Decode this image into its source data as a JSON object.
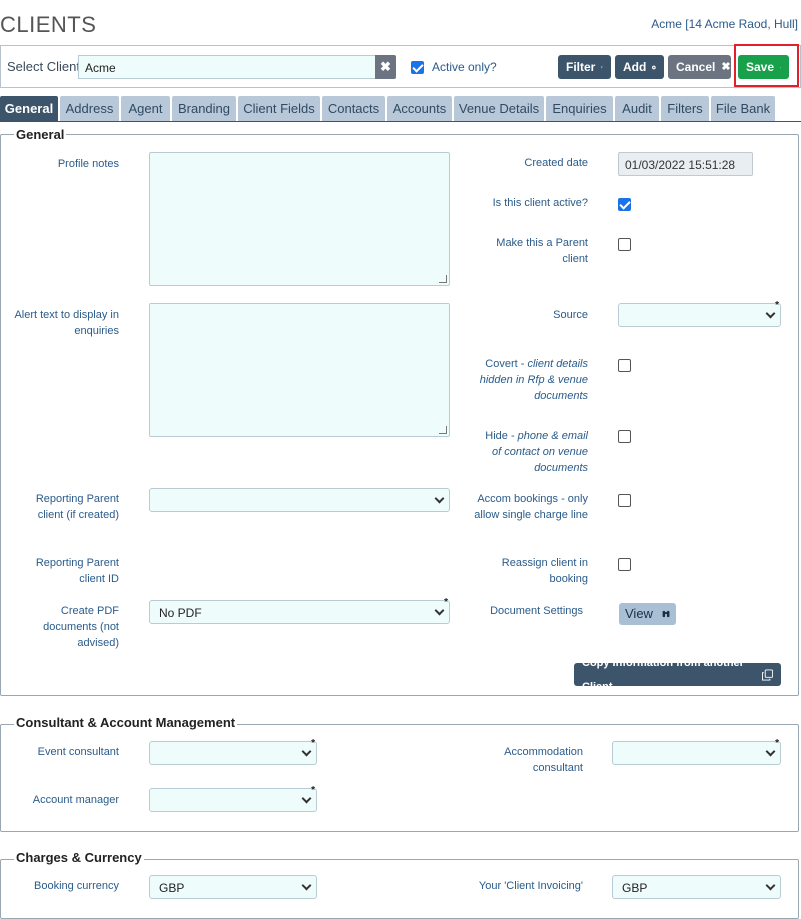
{
  "header": {
    "title": "CLIENTS",
    "client_address": "Acme [14 Acme Raod, Hull]"
  },
  "select_bar": {
    "label": "Select Client",
    "value": "Acme",
    "clear_icon": "times-icon",
    "active_only_label": "Active only?",
    "active_only_checked": true
  },
  "toolbar": {
    "filter": "Filter",
    "add": "Add",
    "cancel": "Cancel",
    "save": "Save"
  },
  "tabs": [
    "General",
    "Address",
    "Agent",
    "Branding",
    "Client Fields",
    "Contacts",
    "Accounts",
    "Venue Details",
    "Enquiries",
    "Audit",
    "Filters",
    "File Bank"
  ],
  "general": {
    "legend": "General",
    "profile_notes_label": "Profile notes",
    "alert_text_label": "Alert text to display in enquiries",
    "reporting_parent_label": "Reporting Parent client (if created)",
    "reporting_parent_id_label": "Reporting Parent client ID",
    "create_pdf_label": "Create PDF documents (not advised)",
    "create_pdf_value": "No PDF",
    "created_date_label": "Created date",
    "created_date_value": "01/03/2022 15:51:28",
    "client_active_label": "Is this client active?",
    "client_active_checked": true,
    "make_parent_label": "Make this a Parent client",
    "source_label": "Source",
    "covert_label_plain": "Covert - ",
    "covert_label_italic": "client details hidden in Rfp & venue documents",
    "hide_label_plain": "Hide - ",
    "hide_label_italic": "phone & email of contact on venue documents",
    "accom_label": "Accom bookings - only allow single charge line",
    "reassign_label": "Reassign client in booking",
    "doc_settings_label": "Document Settings",
    "view_button": "View",
    "copy_button": "Copy Information from another Client"
  },
  "consultant": {
    "legend": "Consultant & Account Management",
    "event_consultant_label": "Event consultant",
    "account_manager_label": "Account manager",
    "accommodation_consultant_label": "Accommodation consultant"
  },
  "charges": {
    "legend": "Charges & Currency",
    "booking_currency_label": "Booking currency",
    "booking_currency_value": "GBP",
    "client_invoicing_label": "Your 'Client Invoicing'",
    "client_invoicing_value": "GBP"
  },
  "colors": {
    "primary": "#3d556b",
    "save_green": "#18a14a",
    "highlight_red": "#e2202a",
    "input_bg": "#effcfc"
  }
}
